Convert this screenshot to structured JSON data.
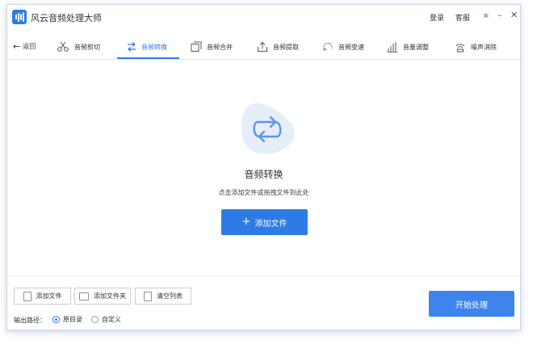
{
  "window": {
    "app_title": "风云音频处理大师",
    "login": "登录",
    "service": "客服"
  },
  "nav": {
    "back": "返回",
    "tabs": [
      {
        "label": "音频剪切",
        "icon": "scissors-icon"
      },
      {
        "label": "音频转换",
        "icon": "convert-icon",
        "active": true
      },
      {
        "label": "音频合并",
        "icon": "merge-icon"
      },
      {
        "label": "音频提取",
        "icon": "extract-icon"
      },
      {
        "label": "音频变速",
        "icon": "speed-icon"
      },
      {
        "label": "音量调整",
        "icon": "volume-bars-icon"
      },
      {
        "label": "噪声消除",
        "icon": "noise-icon"
      }
    ]
  },
  "main": {
    "title": "音频转换",
    "tip": "点击添加文件或拖拽文件到此处",
    "add_file_button": "添加文件"
  },
  "bottom": {
    "add_file": "添加文件",
    "add_folder": "添加文件夹",
    "clear_list": "清空列表",
    "output_path_label": "输出路径：",
    "radio_original": "原目录",
    "radio_custom": "自定义",
    "selected_output": "原目录",
    "start_button": "开始处理"
  },
  "colors": {
    "accent": "#2f7be6",
    "start_button": "#3d84ec",
    "blob": "#e6eefb"
  }
}
